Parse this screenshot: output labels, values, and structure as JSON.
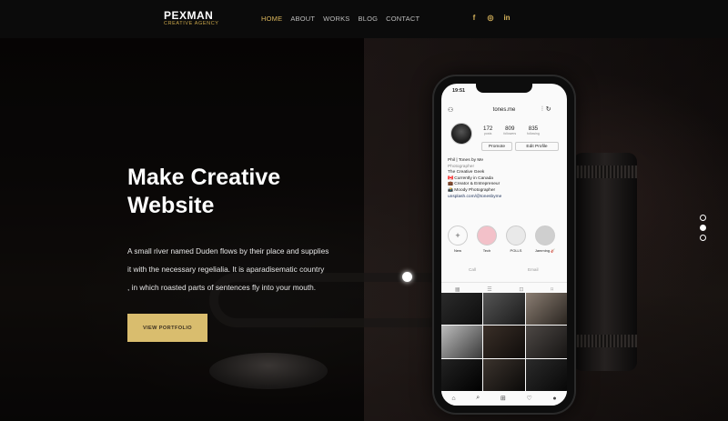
{
  "nav": {
    "logo_name": "PEXMAN",
    "logo_sub": "CREATIVE AGENCY",
    "items": [
      "HOME",
      "ABOUT",
      "WORKS",
      "BLOG",
      "CONTACT"
    ],
    "active_item": "HOME",
    "social": [
      {
        "icon": "facebook-icon",
        "glyph": "f"
      },
      {
        "icon": "instagram-icon",
        "glyph": "◎"
      },
      {
        "icon": "linkedin-icon",
        "glyph": "in"
      }
    ]
  },
  "hero": {
    "title_line1": "Make Creative",
    "title_line2": "Website",
    "desc_line1": "A small river named Duden flows by their place and supplies",
    "desc_line2": "it with the necessary regelialia. It is aparadisematic country",
    "desc_line3": ", in which roasted parts of sentences fly into your mouth.",
    "cta": "VIEW PORTFOLIO"
  },
  "slider": {
    "count": 3,
    "active": 1
  },
  "phone": {
    "time": "19:51",
    "username": "tones.me",
    "stats": [
      {
        "n": "172",
        "l": "posts"
      },
      {
        "n": "809",
        "l": "followers"
      },
      {
        "n": "835",
        "l": "following"
      }
    ],
    "btn_promote": "Promote",
    "btn_edit": "Edit Profile",
    "bio": [
      "Phil | Tones by Me",
      "Photographer",
      "The Creative Geek",
      "🇨🇦 Currently in Canada",
      "💼 Creator & Entrepreneur",
      "📸 Moody Photographer",
      "unsplash.com/@tonesbyme"
    ],
    "highlights": [
      "New",
      "Tech",
      "POLLS",
      "Jamming 🎸"
    ],
    "under_call": "Call",
    "under_email": "Email"
  },
  "colors": {
    "accent": "#d9b55c",
    "cta_bg": "#d9bd6e",
    "nav_bg": "#0b0b0b"
  }
}
